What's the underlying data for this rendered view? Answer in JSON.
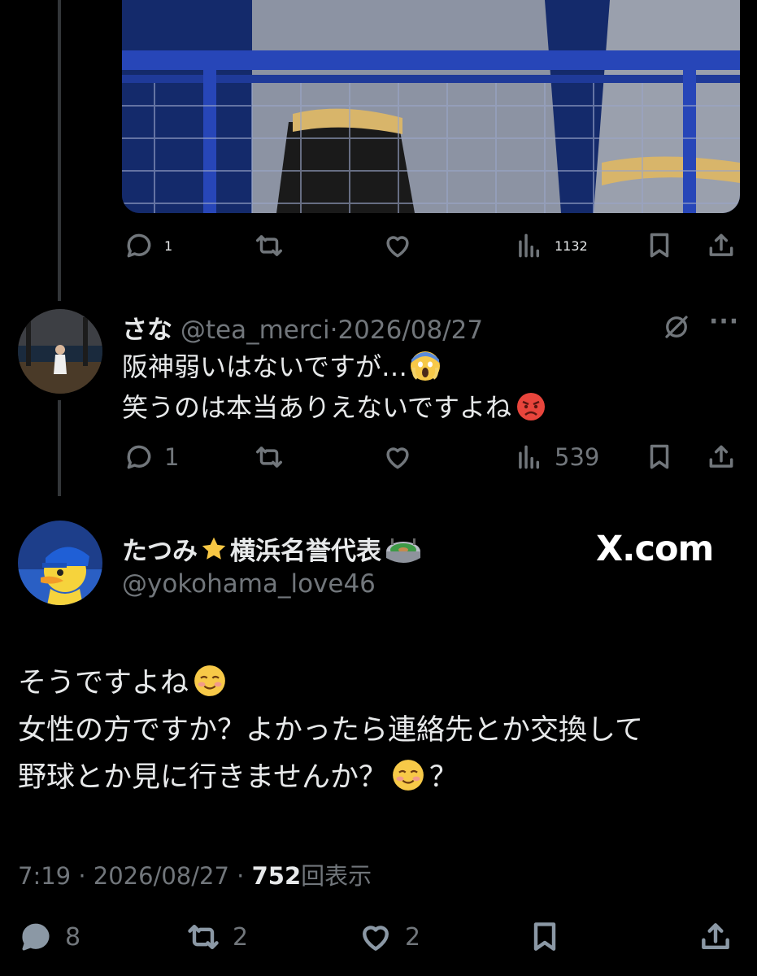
{
  "top_tweet": {
    "stats": {
      "replies": "1",
      "views": "1132"
    }
  },
  "reply": {
    "name": "さな",
    "handle": "@tea_merci",
    "separator": "·",
    "date": "2026/08/27",
    "text_line1": "阪神弱いはないですが…",
    "text_line2": "笑うのは本当ありえないですよね",
    "stats": {
      "replies": "1",
      "views": "539"
    },
    "more_label": "···"
  },
  "main_tweet": {
    "name": "たつみ",
    "name_suffix": "横浜名誉代表",
    "handle": "@yokohama_love46",
    "source_logo": "X.com",
    "text_line1": "そうですよね",
    "text_line2": "女性の方ですか？よかったら連絡先とか交換して",
    "text_line3_a": "野球とか見に行きませんか？",
    "text_line3_b": "？",
    "time": "7:19",
    "dot1": "·",
    "date": "2026/08/27",
    "dot2": "·",
    "views_count": "752",
    "views_label": "回表示",
    "stats": {
      "replies": "8",
      "retweets": "2",
      "likes": "2"
    }
  },
  "icons": [
    "reply-icon",
    "retweet-icon",
    "like-icon",
    "views-icon",
    "bookmark-icon",
    "share-icon",
    "grok-icon",
    "more-icon"
  ],
  "colors": {
    "background": "#000000",
    "text": "#e7e9ea",
    "muted": "#71767b",
    "thread_line": "#333639"
  }
}
